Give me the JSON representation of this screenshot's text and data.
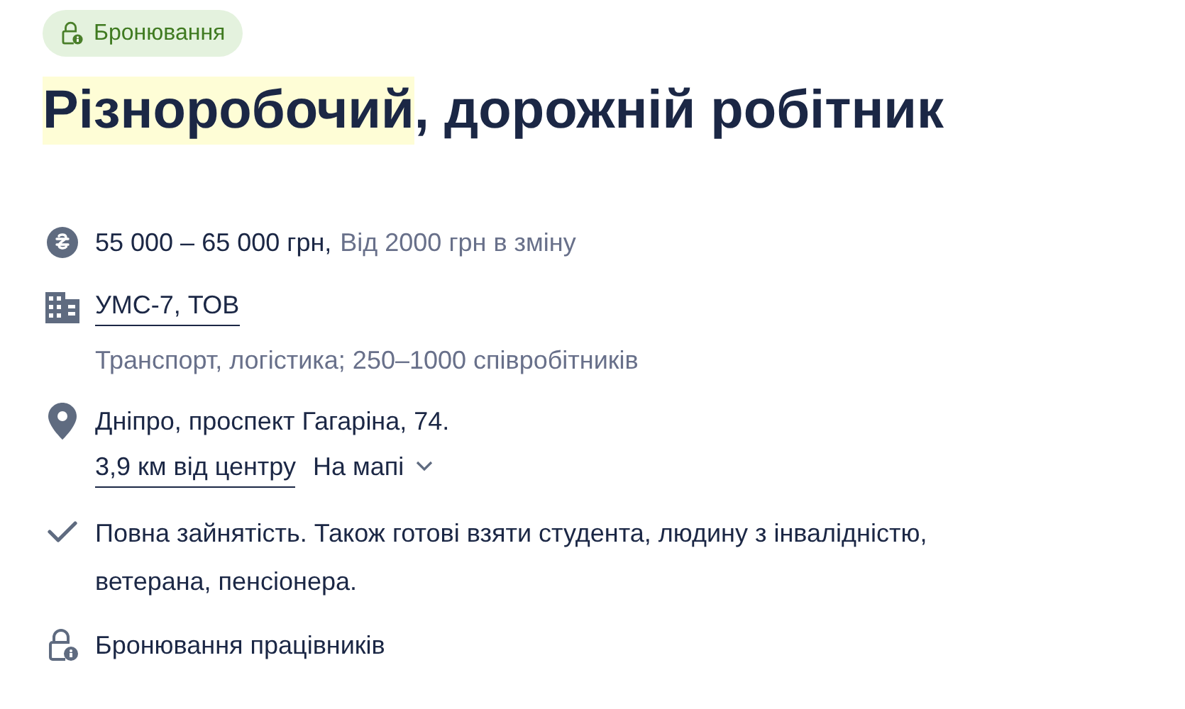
{
  "badge": {
    "label": "Бронювання"
  },
  "title": [
    {
      "text": "Різноробочий",
      "highlighted": true
    },
    {
      "text": ", дорожній робітник",
      "highlighted": false
    }
  ],
  "details": [
    {
      "kind": "salary",
      "text": "55 000 – 65 000 грн,",
      "note": "Від 2000 грн в зміну"
    },
    {
      "kind": "company",
      "link": "УМС-7, ТОВ",
      "note": "Транспорт, логістика; 250–1000 співробітників"
    },
    {
      "kind": "location",
      "text": "Дніпро, проспект Гагаріна, 74.",
      "link": "3,9 км від центру",
      "map_toggle": "На мапі"
    },
    {
      "kind": "employment",
      "text": "Повна зайнятість. Також готові взяти студента, людину з інвалідністю, ветерана, пенсіонера."
    },
    {
      "kind": "reservation",
      "text": "Бронювання працівників"
    }
  ]
}
